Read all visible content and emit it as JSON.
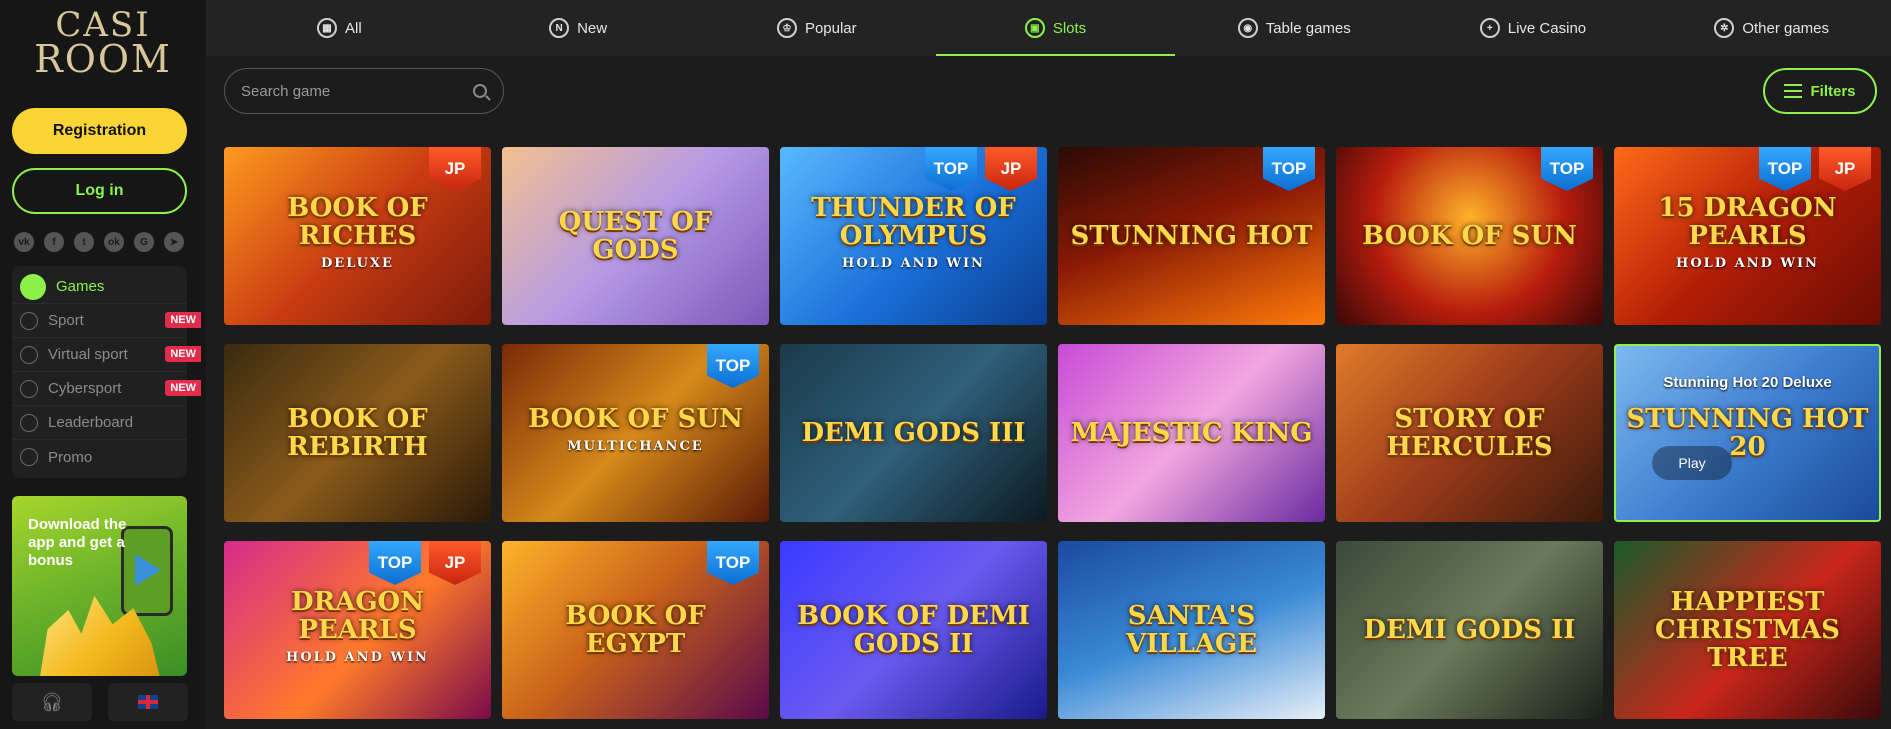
{
  "brand": {
    "line1": "CASI",
    "line2": "ROOM"
  },
  "auth": {
    "register": "Registration",
    "login": "Log in"
  },
  "socials": [
    {
      "icon": "vk-icon",
      "glyph": "vk"
    },
    {
      "icon": "facebook-icon",
      "glyph": "f"
    },
    {
      "icon": "twitter-icon",
      "glyph": "t"
    },
    {
      "icon": "odnoklassniki-icon",
      "glyph": "ok"
    },
    {
      "icon": "google-icon",
      "glyph": "G"
    },
    {
      "icon": "telegram-icon",
      "glyph": "➤"
    }
  ],
  "menu": [
    {
      "label": "Games",
      "icon": "games-icon",
      "active": true,
      "badge": ""
    },
    {
      "label": "Sport",
      "icon": "sport-icon",
      "active": false,
      "badge": "NEW"
    },
    {
      "label": "Virtual sport",
      "icon": "virtual-sport-icon",
      "active": false,
      "badge": "NEW"
    },
    {
      "label": "Cybersport",
      "icon": "gamepad-icon",
      "active": false,
      "badge": "NEW"
    },
    {
      "label": "Leaderboard",
      "icon": "leaderboard-icon",
      "active": false,
      "badge": ""
    },
    {
      "label": "Promo",
      "icon": "diamond-icon",
      "active": false,
      "badge": ""
    }
  ],
  "promo": {
    "text": "Download the app and get a bonus"
  },
  "tabs": [
    {
      "label": "All",
      "icon": "grid-icon",
      "glyph": "▦",
      "active": false
    },
    {
      "label": "New",
      "icon": "new-icon",
      "glyph": "N",
      "active": false
    },
    {
      "label": "Popular",
      "icon": "popular-icon",
      "glyph": "♔",
      "active": false
    },
    {
      "label": "Slots",
      "icon": "slots-icon",
      "glyph": "▣",
      "active": true
    },
    {
      "label": "Table games",
      "icon": "table-games-icon",
      "glyph": "◉",
      "active": false
    },
    {
      "label": "Live Casino",
      "icon": "live-casino-icon",
      "glyph": "+",
      "active": false
    },
    {
      "label": "Other games",
      "icon": "other-games-icon",
      "glyph": "✲",
      "active": false
    }
  ],
  "search": {
    "placeholder": "Search game"
  },
  "filters": {
    "label": "Filters"
  },
  "games": [
    {
      "title": "BOOK OF RICHES",
      "sub": "DELUXE",
      "bg": "linear-gradient(135deg,#ff9a1f,#c93c12 50%,#7a1a0a)",
      "ribbons": [
        "JP"
      ]
    },
    {
      "title": "QUEST OF GODS",
      "sub": "",
      "bg": "linear-gradient(135deg,#f3c08f,#b69ae6 50%,#7a5ab8)",
      "ribbons": []
    },
    {
      "title": "THUNDER OF OLYMPUS",
      "sub": "HOLD AND WIN",
      "bg": "linear-gradient(135deg,#59b9ff,#1a6fd8 55%,#0b3d8f)",
      "ribbons": [
        "TOP",
        "JP"
      ]
    },
    {
      "title": "STUNNING HOT",
      "sub": "",
      "bg": "linear-gradient(160deg,#2a0a05,#8a1a05 45%,#ff7a0a)",
      "ribbons": [
        "TOP"
      ]
    },
    {
      "title": "BOOK OF SUN",
      "sub": "",
      "bg": "radial-gradient(circle at 50% 40%,#ffb32a,#b81d0d 55%,#3a0707)",
      "ribbons": [
        "TOP"
      ]
    },
    {
      "title": "15 DRAGON PEARLS",
      "sub": "HOLD AND WIN",
      "bg": "linear-gradient(135deg,#ff6a1a,#b31d06 50%,#6a0c04)",
      "ribbons": [
        "TOP",
        "JP"
      ]
    },
    {
      "title": "BOOK OF REBIRTH",
      "sub": "",
      "bg": "linear-gradient(135deg,#3a2a10,#8a5a1a 50%,#2a1a08)",
      "ribbons": []
    },
    {
      "title": "BOOK OF SUN",
      "sub": "MULTICHANCE",
      "bg": "linear-gradient(135deg,#7a2a08,#d6891a 50%,#5a1a06)",
      "ribbons": [
        "TOP"
      ]
    },
    {
      "title": "DEMI GODS III",
      "sub": "",
      "bg": "linear-gradient(135deg,#1a3a4a,#2f5f7a 50%,#0c1a22)",
      "ribbons": []
    },
    {
      "title": "MAJESTIC KING",
      "sub": "",
      "bg": "linear-gradient(135deg,#c84ad6,#f2a7e0 50%,#6a2aa0)",
      "ribbons": []
    },
    {
      "title": "STORY OF HERCULES",
      "sub": "",
      "bg": "linear-gradient(135deg,#e07a2a,#9a3a1a 50%,#3a1a0a)",
      "ribbons": []
    },
    {
      "title": "STUNNING HOT 20",
      "sub": "",
      "bg": "linear-gradient(135deg,#7fb9f0,#3f7fd0 50%,#1a4a9a)",
      "ribbons": [],
      "hover": {
        "name": "Stunning Hot 20 Deluxe",
        "play": "Play"
      }
    },
    {
      "title": "DRAGON PEARLS",
      "sub": "HOLD AND WIN",
      "bg": "linear-gradient(135deg,#d62a8a,#ff7a2a 55%,#7a0a4a)",
      "ribbons": [
        "TOP",
        "JP"
      ]
    },
    {
      "title": "BOOK OF EGYPT",
      "sub": "",
      "bg": "linear-gradient(135deg,#ffb32a,#c9621a 45%,#5a0a4a)",
      "ribbons": [
        "TOP"
      ]
    },
    {
      "title": "BOOK OF DEMI GODS II",
      "sub": "",
      "bg": "linear-gradient(135deg,#3a3aff,#6a5af0 50%,#1a1a8a)",
      "ribbons": []
    },
    {
      "title": "Santa's Village",
      "sub": "",
      "bg": "linear-gradient(160deg,#1a4aa0,#3a8ad6 50%,#e6eef8)",
      "ribbons": []
    },
    {
      "title": "DEMI GODS II",
      "sub": "",
      "bg": "linear-gradient(135deg,#3a4a3a,#6a7a5a 50%,#1a201a)",
      "ribbons": []
    },
    {
      "title": "HAPPIEST CHRISTMAS TREE",
      "sub": "",
      "bg": "linear-gradient(135deg,#1a5a2a,#c9261a 55%,#3a0a0a)",
      "ribbons": []
    }
  ],
  "bottom": {
    "support_icon": "headset-icon",
    "lang_icon": "uk-flag-icon"
  }
}
